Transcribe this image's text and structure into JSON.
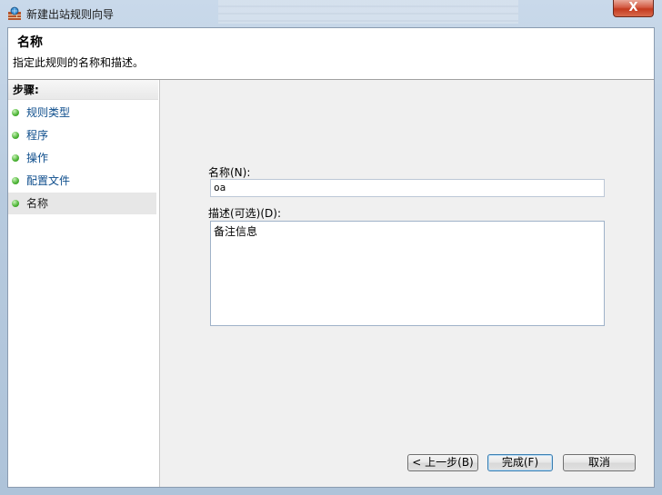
{
  "window": {
    "title": "新建出站规则向导",
    "close_glyph": "X"
  },
  "header": {
    "title": "名称",
    "subtitle": "指定此规则的名称和描述。"
  },
  "steps": {
    "heading": "步骤:",
    "items": [
      {
        "label": "规则类型"
      },
      {
        "label": "程序"
      },
      {
        "label": "操作"
      },
      {
        "label": "配置文件"
      },
      {
        "label": "名称"
      }
    ],
    "current_index": 4
  },
  "form": {
    "name_label": "名称(N):",
    "name_value": "oa",
    "desc_label": "描述(可选)(D):",
    "desc_value": "备注信息"
  },
  "buttons": {
    "back": "< 上一步(B)",
    "finish": "完成(F)",
    "cancel": "取消"
  },
  "colors": {
    "step_link": "#0d4d8c",
    "close_button": "#c43a1f",
    "step_dot": "#4bb334"
  },
  "icons": [
    "wall-fire-icon",
    "close-icon",
    "step-bullet-icon"
  ]
}
